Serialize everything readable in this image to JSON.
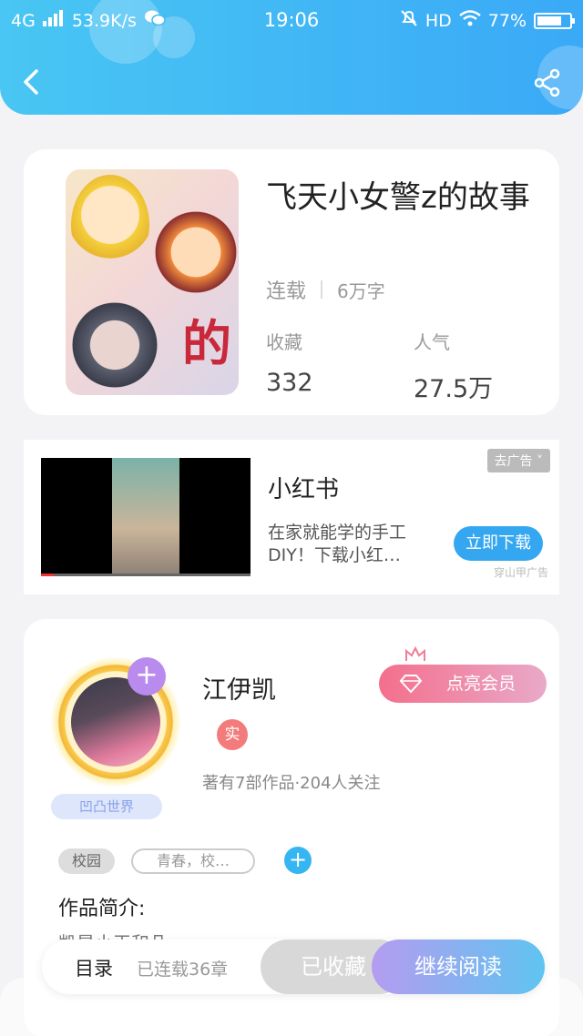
{
  "status_bar": {
    "network": "4G",
    "speed": "53.9K/s",
    "time": "19:06",
    "hd": "HD",
    "battery": "77%",
    "battery_level": 0.77
  },
  "book": {
    "title": "飞天小女警z的故事",
    "status": "连载",
    "word_count": "6万字",
    "cover_text": "的",
    "stats": [
      {
        "label": "收藏",
        "value": "332"
      },
      {
        "label": "人气",
        "value": "27.5万"
      }
    ]
  },
  "ad": {
    "title": "小红书",
    "description": "在家就能学的手工DIY！下载小红…",
    "close_label": "去广告",
    "download_label": "立即下载",
    "source": "穿山甲广告"
  },
  "author": {
    "name": "江伊凯",
    "vip_label": "点亮会员",
    "real_badge": "实",
    "info": "著有7部作品·204人关注",
    "world_badge": "凹凸世界",
    "follow_symbol": "+"
  },
  "tags": {
    "items": [
      "校园"
    ],
    "input_value": "青春，校…",
    "add_symbol": "+"
  },
  "intro": {
    "title": "作品简介:",
    "preview": "凯是小王和几"
  },
  "bottom_bar": {
    "toc_label": "目录",
    "chapter_count": "已连载36章",
    "collected_label": "已收藏",
    "continue_label": "继续阅读"
  },
  "colors": {
    "header_start": "#49c6f3",
    "header_end": "#3aa9f7",
    "accent_blue": "#35a7f0",
    "vip_pink": "#f46f8c",
    "read_purple": "#b59cf0"
  },
  "icons": {
    "back": "chevron-left-icon",
    "share": "share-icon",
    "wifi": "wifi-icon",
    "signal": "signal-icon",
    "wechat": "wechat-icon",
    "mute": "bell-off-icon",
    "vip": "diamond-icon",
    "crown": "crown-icon"
  }
}
